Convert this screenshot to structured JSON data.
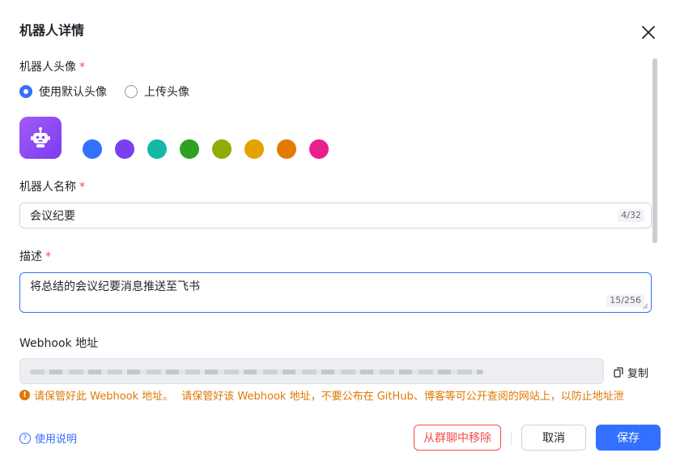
{
  "dialog": {
    "title": "机器人详情"
  },
  "avatar_section": {
    "label": "机器人头像",
    "required_mark": "*",
    "options": [
      {
        "label": "使用默认头像",
        "selected": true
      },
      {
        "label": "上传头像",
        "selected": false
      }
    ],
    "avatar_icon": "robot-icon",
    "swatches": [
      "#3370ff",
      "#7b3ff2",
      "#14b8a6",
      "#2ea121",
      "#8fac02",
      "#e3a200",
      "#e37a00",
      "#ea1f8e"
    ]
  },
  "name_section": {
    "label": "机器人名称",
    "required_mark": "*",
    "value": "会议纪要",
    "counter": "4/32"
  },
  "desc_section": {
    "label": "描述",
    "required_mark": "*",
    "value": "将总结的会议纪要消息推送至飞书",
    "counter": "15/256"
  },
  "webhook_section": {
    "label": "Webhook 地址",
    "copy_label": "复制",
    "warning_1": "请保管好此 Webhook 地址。",
    "warning_2": "请保管好该 Webhook 地址，不要公布在 GitHub、博客等可公开查阅的网站上，以防止地址泄"
  },
  "footer": {
    "help_label": "使用说明",
    "remove_label": "从群聊中移除",
    "cancel_label": "取消",
    "save_label": "保存"
  },
  "colors": {
    "primary": "#3370ff",
    "danger": "#f54a45",
    "warning": "#de7802"
  }
}
